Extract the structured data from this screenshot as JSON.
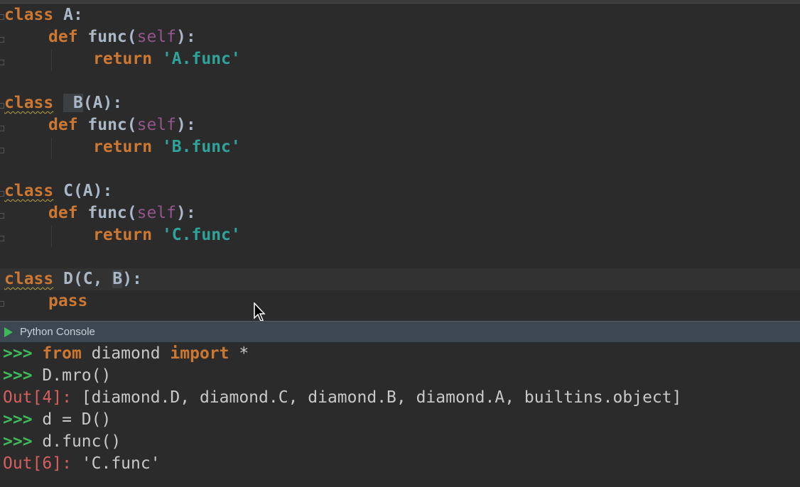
{
  "editor": {
    "lines": [
      {
        "kw": "class",
        "name": " A",
        "rest": ":"
      },
      {
        "kw": "def",
        "name": " func(",
        "self": "self",
        "rest": "):"
      },
      {
        "kw": "return",
        "str": "'A.func'"
      },
      {
        "kw": "class",
        "name": " B",
        "rest": "(A):"
      },
      {
        "kw": "def",
        "name": " func(",
        "self": "self",
        "rest": "):"
      },
      {
        "kw": "return",
        "str": "'B.func'"
      },
      {
        "kw": "class",
        "name": " C",
        "rest": "(A):"
      },
      {
        "kw": "def",
        "name": " func(",
        "self": "self",
        "rest": "):"
      },
      {
        "kw": "return",
        "str": "'C.func'"
      },
      {
        "kw": "class",
        "name": " D",
        "rest_a": "(C, ",
        "hl": "B",
        "rest_b": "):"
      },
      {
        "kw": "pass"
      }
    ]
  },
  "console": {
    "title": "Python Console",
    "lines": [
      {
        "prompt": ">>>",
        "kw1": "from",
        "mid": " diamond ",
        "kw2": "import",
        "tail": " *"
      },
      {
        "prompt": ">>>",
        "text": "D.mro()"
      },
      {
        "out": "Out[4]:",
        "text": " [diamond.D, diamond.C, diamond.B, diamond.A, builtins.object]"
      },
      {
        "prompt": ">>>",
        "text": "d = D()"
      },
      {
        "prompt": ">>>",
        "text": "d.func()"
      },
      {
        "out": "Out[6]:",
        "text": " 'C.func'"
      }
    ]
  }
}
